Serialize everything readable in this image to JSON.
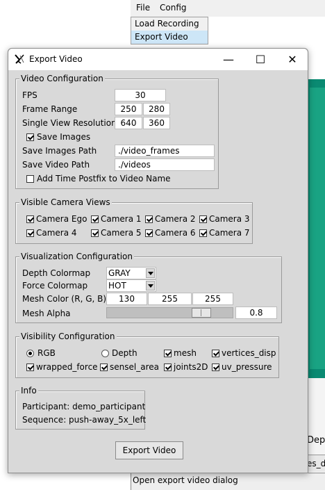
{
  "app": {
    "menu": [
      "File",
      "Config"
    ],
    "dropdown_items": [
      "Load Recording",
      "Export Video"
    ],
    "status": "Open export video dialog",
    "background_text_dep": "Dep",
    "background_text_es": "es_d"
  },
  "dialog": {
    "title": "Export Video",
    "window_controls": [
      "—",
      "☐",
      "✕"
    ],
    "video_config": {
      "title": "Video Configuration",
      "fps_label": "FPS",
      "fps": "30",
      "frame_range_label": "Frame Range",
      "frame_start": "250",
      "frame_end": "280",
      "resolution_label": "Single View Resolution",
      "res_w": "640",
      "res_h": "360",
      "save_images_label": "Save Images",
      "save_images_checked": true,
      "images_path_label": "Save Images Path",
      "images_path": "./video_frames",
      "video_path_label": "Save Video Path",
      "video_path": "./videos",
      "postfix_label": "Add Time Postfix to Video Name",
      "postfix_checked": false
    },
    "cameras": {
      "title": "Visible Camera Views",
      "items": [
        {
          "label": "Camera Ego",
          "checked": true
        },
        {
          "label": "Camera 1",
          "checked": true
        },
        {
          "label": "Camera 2",
          "checked": true
        },
        {
          "label": "Camera 3",
          "checked": true
        },
        {
          "label": "Camera 4",
          "checked": true
        },
        {
          "label": "Camera 5",
          "checked": true
        },
        {
          "label": "Camera 6",
          "checked": true
        },
        {
          "label": "Camera 7",
          "checked": true
        }
      ]
    },
    "vis_config": {
      "title": "Visualization Configuration",
      "depth_label": "Depth Colormap",
      "depth_value": "GRAY",
      "force_label": "Force Colormap",
      "force_value": "HOT",
      "mesh_color_label": "Mesh Color (R, G, B)",
      "mesh_r": "130",
      "mesh_g": "255",
      "mesh_b": "255",
      "alpha_label": "Mesh Alpha",
      "alpha": "0.8",
      "alpha_fraction": 0.8
    },
    "visibility": {
      "title": "Visibility Configuration",
      "items": [
        {
          "label": "RGB",
          "kind": "radio",
          "checked": true
        },
        {
          "label": "Depth",
          "kind": "radio",
          "checked": false
        },
        {
          "label": "mesh",
          "kind": "check",
          "checked": true
        },
        {
          "label": "vertices_disp",
          "kind": "check",
          "checked": true
        },
        {
          "label": "wrapped_force",
          "kind": "check",
          "checked": true
        },
        {
          "label": "sensel_area",
          "kind": "check",
          "checked": true
        },
        {
          "label": "joints2D",
          "kind": "check",
          "checked": true
        },
        {
          "label": "uv_pressure",
          "kind": "check",
          "checked": true
        }
      ]
    },
    "info": {
      "title": "Info",
      "participant": "Participant: demo_participant",
      "sequence": "Sequence: push-away_5x_left"
    },
    "export_button": "Export Video"
  }
}
